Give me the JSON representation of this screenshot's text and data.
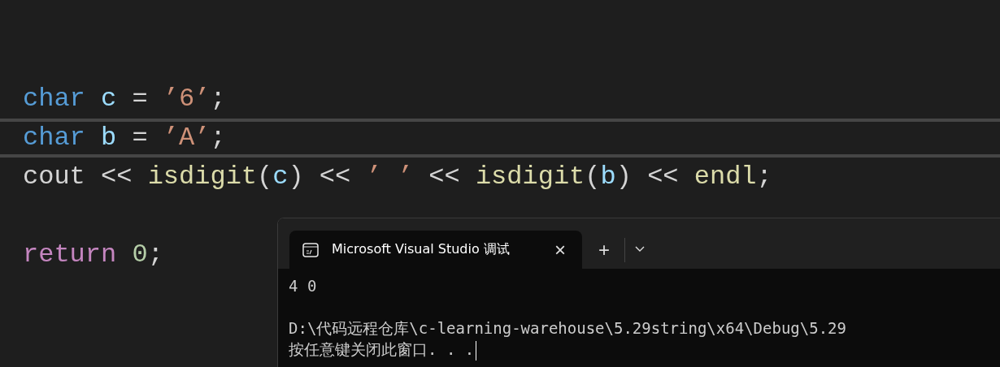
{
  "editor": {
    "lines": [
      {
        "kind": "code",
        "current": false,
        "tokens": [
          {
            "kind": "keyword",
            "text": "char"
          },
          {
            "kind": "variable",
            "text": " c"
          },
          {
            "kind": "plain",
            "text": " = "
          },
          {
            "kind": "string",
            "text": "’6’"
          },
          {
            "kind": "plain",
            "text": ";"
          }
        ]
      },
      {
        "kind": "code",
        "current": true,
        "tokens": [
          {
            "kind": "keyword",
            "text": "char"
          },
          {
            "kind": "variable",
            "text": " b"
          },
          {
            "kind": "plain",
            "text": " = "
          },
          {
            "kind": "string",
            "text": "’A’"
          },
          {
            "kind": "plain",
            "text": ";"
          }
        ]
      },
      {
        "kind": "code",
        "current": false,
        "tokens": [
          {
            "kind": "plain",
            "text": "cout << "
          },
          {
            "kind": "function",
            "text": "isdigit"
          },
          {
            "kind": "plain",
            "text": "("
          },
          {
            "kind": "variable",
            "text": "c"
          },
          {
            "kind": "plain",
            "text": ") << "
          },
          {
            "kind": "string",
            "text": "’ ’"
          },
          {
            "kind": "plain",
            "text": " << "
          },
          {
            "kind": "function",
            "text": "isdigit"
          },
          {
            "kind": "plain",
            "text": "("
          },
          {
            "kind": "variable",
            "text": "b"
          },
          {
            "kind": "plain",
            "text": ") << "
          },
          {
            "kind": "function",
            "text": "endl"
          },
          {
            "kind": "plain",
            "text": ";"
          }
        ]
      },
      {
        "kind": "blank",
        "current": false
      },
      {
        "kind": "code",
        "current": false,
        "tokens": [
          {
            "kind": "control",
            "text": "return"
          },
          {
            "kind": "number",
            "text": " 0"
          },
          {
            "kind": "plain",
            "text": ";"
          }
        ]
      }
    ]
  },
  "terminal": {
    "tab": {
      "title": "Microsoft Visual Studio 调试",
      "selected": true,
      "close": "×"
    },
    "new_tab": "+",
    "output": [
      {
        "kind": "text",
        "text": "4 0"
      },
      {
        "kind": "blank"
      },
      {
        "kind": "text",
        "text": "D:\\代码远程仓库\\c-learning-warehouse\\5.29string\\x64\\Debug\\5.29"
      },
      {
        "kind": "text",
        "text": "按任意键关闭此窗口. . ."
      }
    ]
  }
}
